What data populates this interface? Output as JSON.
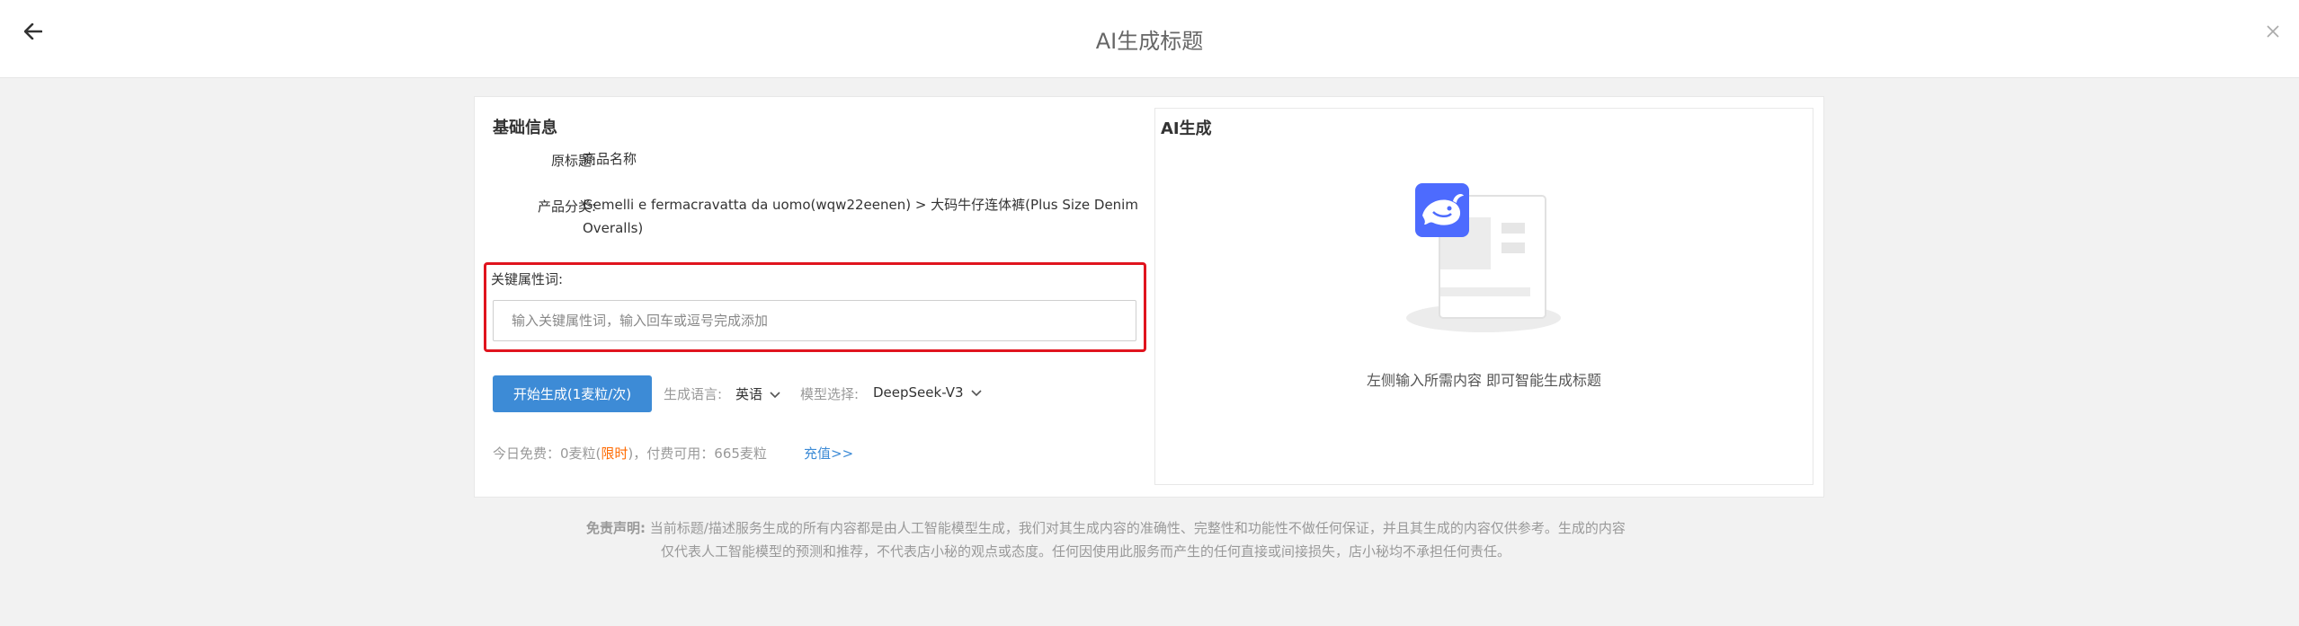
{
  "header": {
    "title": "AI生成标题",
    "back_icon": "arrow-left-icon",
    "close_icon": "close-icon"
  },
  "basic_info": {
    "section_title": "基础信息",
    "original_title_label": "原标题:",
    "original_title_value": "商品名称",
    "category_label": "产品分类:",
    "category_value_line1": "Gemelli e fermacravatta da uomo(wqw22eenen) > 大码牛仔连体裤(Plus Size Denim",
    "category_value_line2": "Overalls)"
  },
  "keywords": {
    "label": "关键属性词:",
    "placeholder": "输入关键属性词，输入回车或逗号完成添加",
    "value": ""
  },
  "actions": {
    "generate_button": "开始生成(1麦粒/次)",
    "language_label": "生成语言:",
    "language_value": "英语",
    "model_label": "模型选择:",
    "model_value": "DeepSeek-V3"
  },
  "quota": {
    "prefix": "今日免费：0麦粒(",
    "limited": "限时",
    "suffix": ")，付费可用：665麦粒",
    "recharge": "充值>>"
  },
  "ai_panel": {
    "title": "AI生成",
    "hint": "左侧输入所需内容 即可智能生成标题",
    "illustration_icon": "deepseek-whale-icon"
  },
  "disclaimer": {
    "head": "免责声明:",
    "line1": "当前标题/描述服务生成的所有内容都是由人工智能模型生成，我们对其生成内容的准确性、完整性和功能性不做任何保证，并且其生成的内容仅供参考。生成的内容",
    "line2": "仅代表人工智能模型的预测和推荐，不代表店小秘的观点或态度。任何因使用此服务而产生的任何直接或间接损失，店小秘均不承担任何责任。"
  },
  "colors": {
    "primary": "#3d8bd6",
    "highlight_border": "#e0141e",
    "limited_text": "#ff6a00",
    "page_bg": "#f2f2f2"
  }
}
